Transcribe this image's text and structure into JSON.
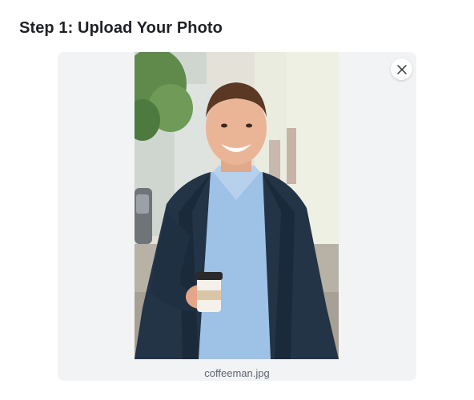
{
  "step": {
    "title": "Step 1: Upload Your Photo"
  },
  "upload": {
    "file_name": "coffeeman.jpg",
    "remove_icon": "close-icon",
    "image_description_icon": "uploaded-photo"
  },
  "colors": {
    "card_background": "#f2f3f5",
    "title_text": "#1f2126",
    "caption_text": "#5f6570"
  }
}
